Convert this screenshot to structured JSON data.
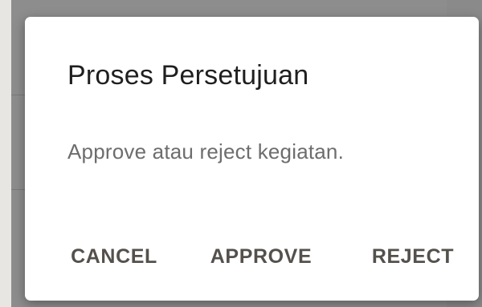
{
  "dialog": {
    "title": "Proses Persetujuan",
    "message": "Approve atau reject kegiatan.",
    "actions": {
      "cancel_label": "CANCEL",
      "approve_label": "APPROVE",
      "reject_label": "REJECT"
    }
  },
  "colors": {
    "dialog_background": "#ffffff",
    "title_text": "#1f1f1f",
    "message_text": "#6d6d6d",
    "action_text": "#54504c",
    "scrim": "#8d8d8d"
  }
}
